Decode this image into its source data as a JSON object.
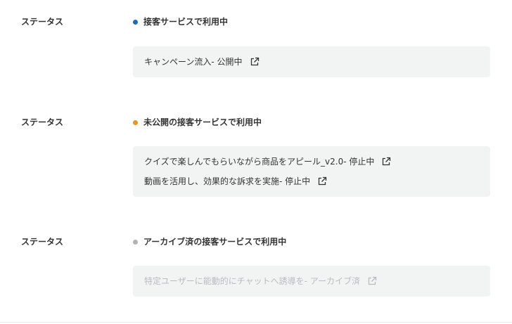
{
  "sections": [
    {
      "label": "ステータス",
      "status": "接客サービスで利用中",
      "dot_color": "#1e6bb8",
      "links": [
        {
          "text": "キャンペーン流入- 公開中",
          "muted": false
        }
      ]
    },
    {
      "label": "ステータス",
      "status": "未公開の接客サービスで利用中",
      "dot_color": "#e8961e",
      "links": [
        {
          "text": "クイズで楽しんでもらいながら商品をアピール_v2.0- 停止中",
          "muted": false
        },
        {
          "text": "動画を活用し、効果的な訴求を実施- 停止中",
          "muted": false
        }
      ]
    },
    {
      "label": "ステータス",
      "status": "アーカイブ済の接客サービスで利用中",
      "dot_color": "#b3b3b3",
      "links": [
        {
          "text": "特定ユーザーに能動的にチャットへ誘導を- アーカイブ済",
          "muted": true
        }
      ]
    }
  ],
  "icons": {
    "external_link": "external-link-icon"
  }
}
